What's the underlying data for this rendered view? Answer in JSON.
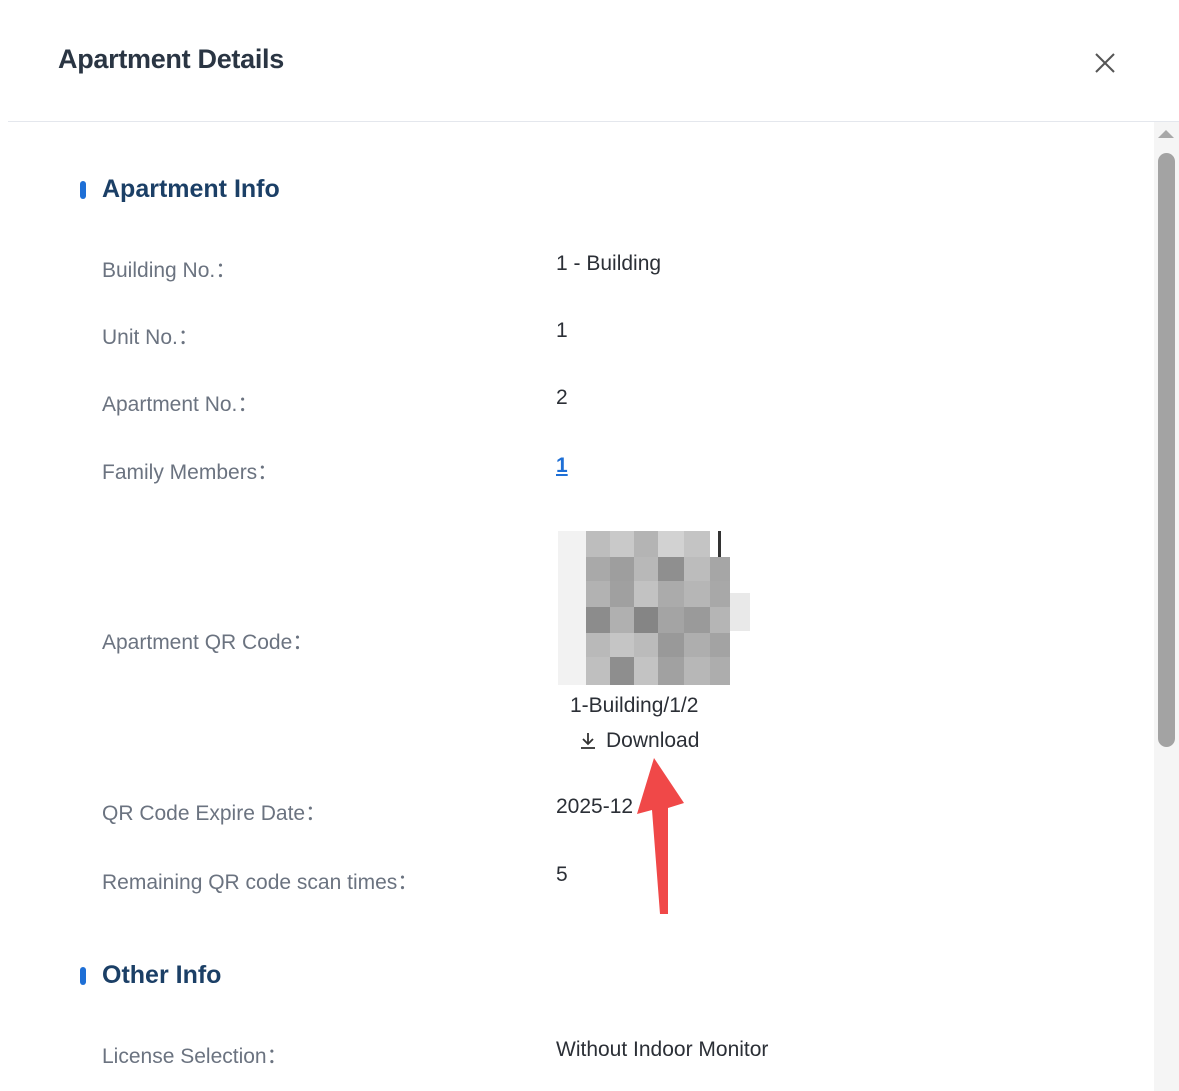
{
  "dialog": {
    "title": "Apartment Details"
  },
  "sections": {
    "apartment_info": {
      "title": "Apartment Info",
      "building_label": "Building No.：",
      "building_value": "1 - Building",
      "unit_label": "Unit No.：",
      "unit_value": "1",
      "apartment_label": "Apartment No.：",
      "apartment_value": "2",
      "family_label": "Family Members：",
      "family_value": "1",
      "qr_label": "Apartment QR Code：",
      "qr_caption": "1-Building/1/2",
      "download_label": "Download",
      "expire_label": "QR Code Expire Date：",
      "expire_value": "2025-12",
      "scan_label": "Remaining QR code scan times：",
      "scan_value": "5"
    },
    "other_info": {
      "title": "Other Info",
      "license_label": "License Selection：",
      "license_value": "Without Indoor Monitor"
    }
  },
  "icons": {
    "close": "close-icon",
    "download": "download-icon",
    "qr": "qr-code-image"
  },
  "colors": {
    "accent": "#1e6fd6",
    "section_title": "#1b3f66",
    "label": "#6b7380",
    "annotation_arrow": "#f04848"
  }
}
